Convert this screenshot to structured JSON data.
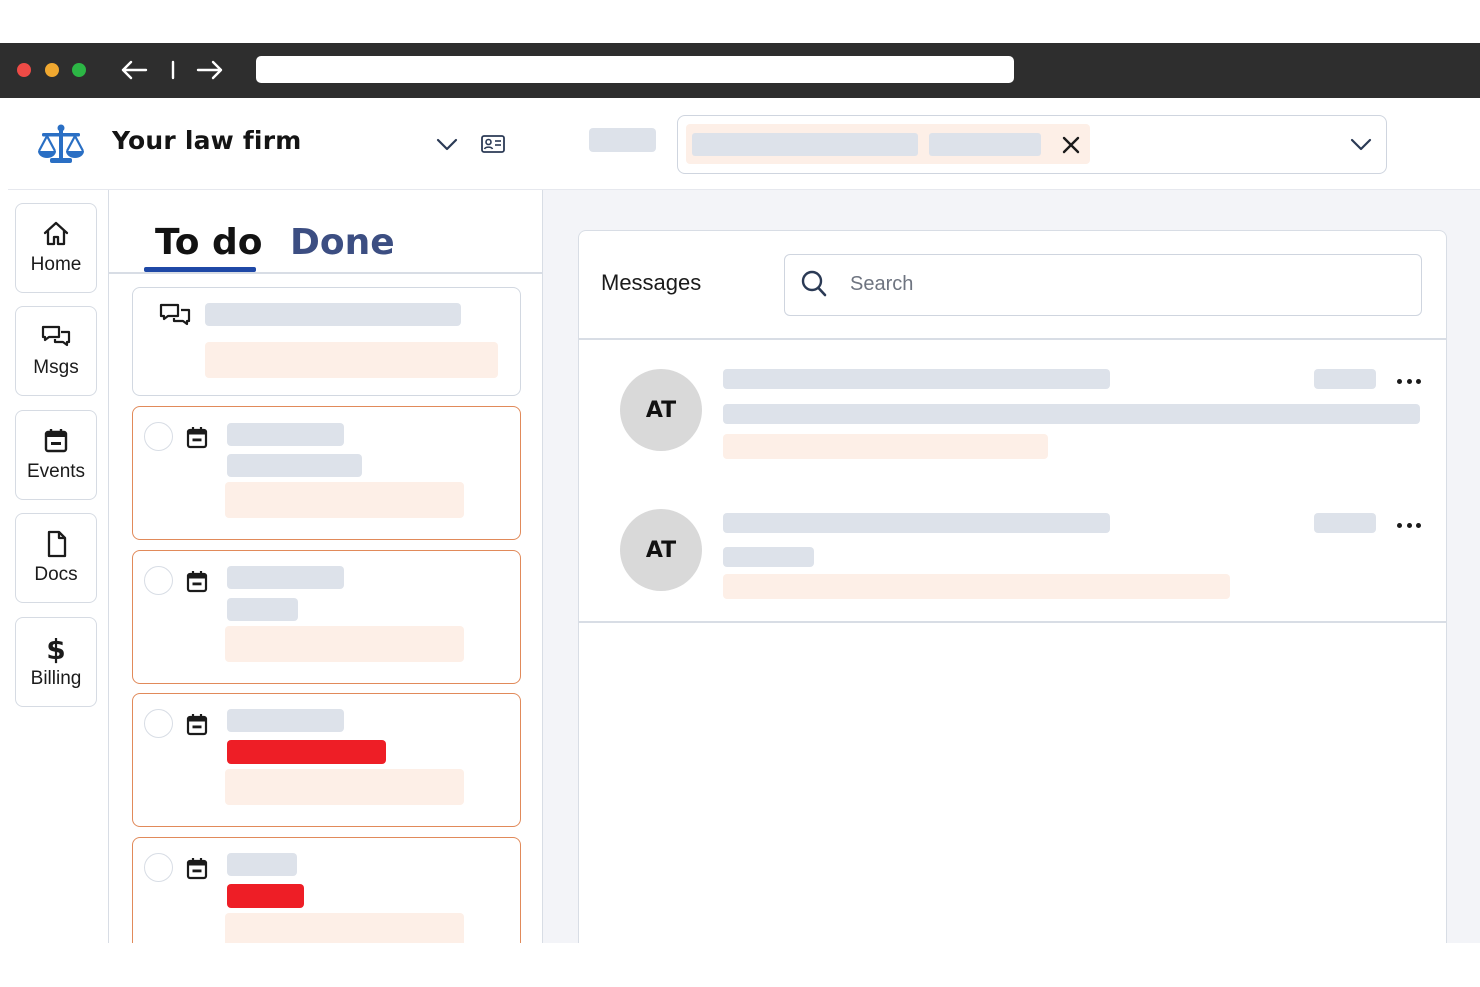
{
  "browser": {
    "window_controls": [
      "close",
      "minimize",
      "maximize"
    ],
    "window_control_colors": {
      "close": "#ee4b46",
      "minimize": "#f0a830",
      "maximize": "#2cb645"
    },
    "back_icon": "arrow-left-icon",
    "forward_icon": "arrow-right-icon",
    "url": ""
  },
  "header": {
    "firm_name": "Your law firm",
    "logo_icon": "scales-of-justice-icon",
    "brand_color": "#2a6fc4"
  },
  "sidebar": {
    "items": [
      {
        "label": "Home",
        "icon": "house-icon"
      },
      {
        "label": "Msgs",
        "icon": "chat-bubbles-icon"
      },
      {
        "label": "Events",
        "icon": "calendar-icon"
      },
      {
        "label": "Docs",
        "icon": "document-icon"
      },
      {
        "label": "Billing",
        "icon": "dollar-icon"
      }
    ]
  },
  "tasks": {
    "tabs": [
      {
        "label": "To do",
        "active": true
      },
      {
        "label": "Done",
        "active": false
      }
    ],
    "accent_color": "#1f48a6",
    "card_border_color": "#e18a5a",
    "overdue_color": "#ee1e26"
  },
  "messages": {
    "title": "Messages",
    "search_placeholder": "Search",
    "threads": [
      {
        "initials": "AT"
      },
      {
        "initials": "AT"
      }
    ]
  }
}
